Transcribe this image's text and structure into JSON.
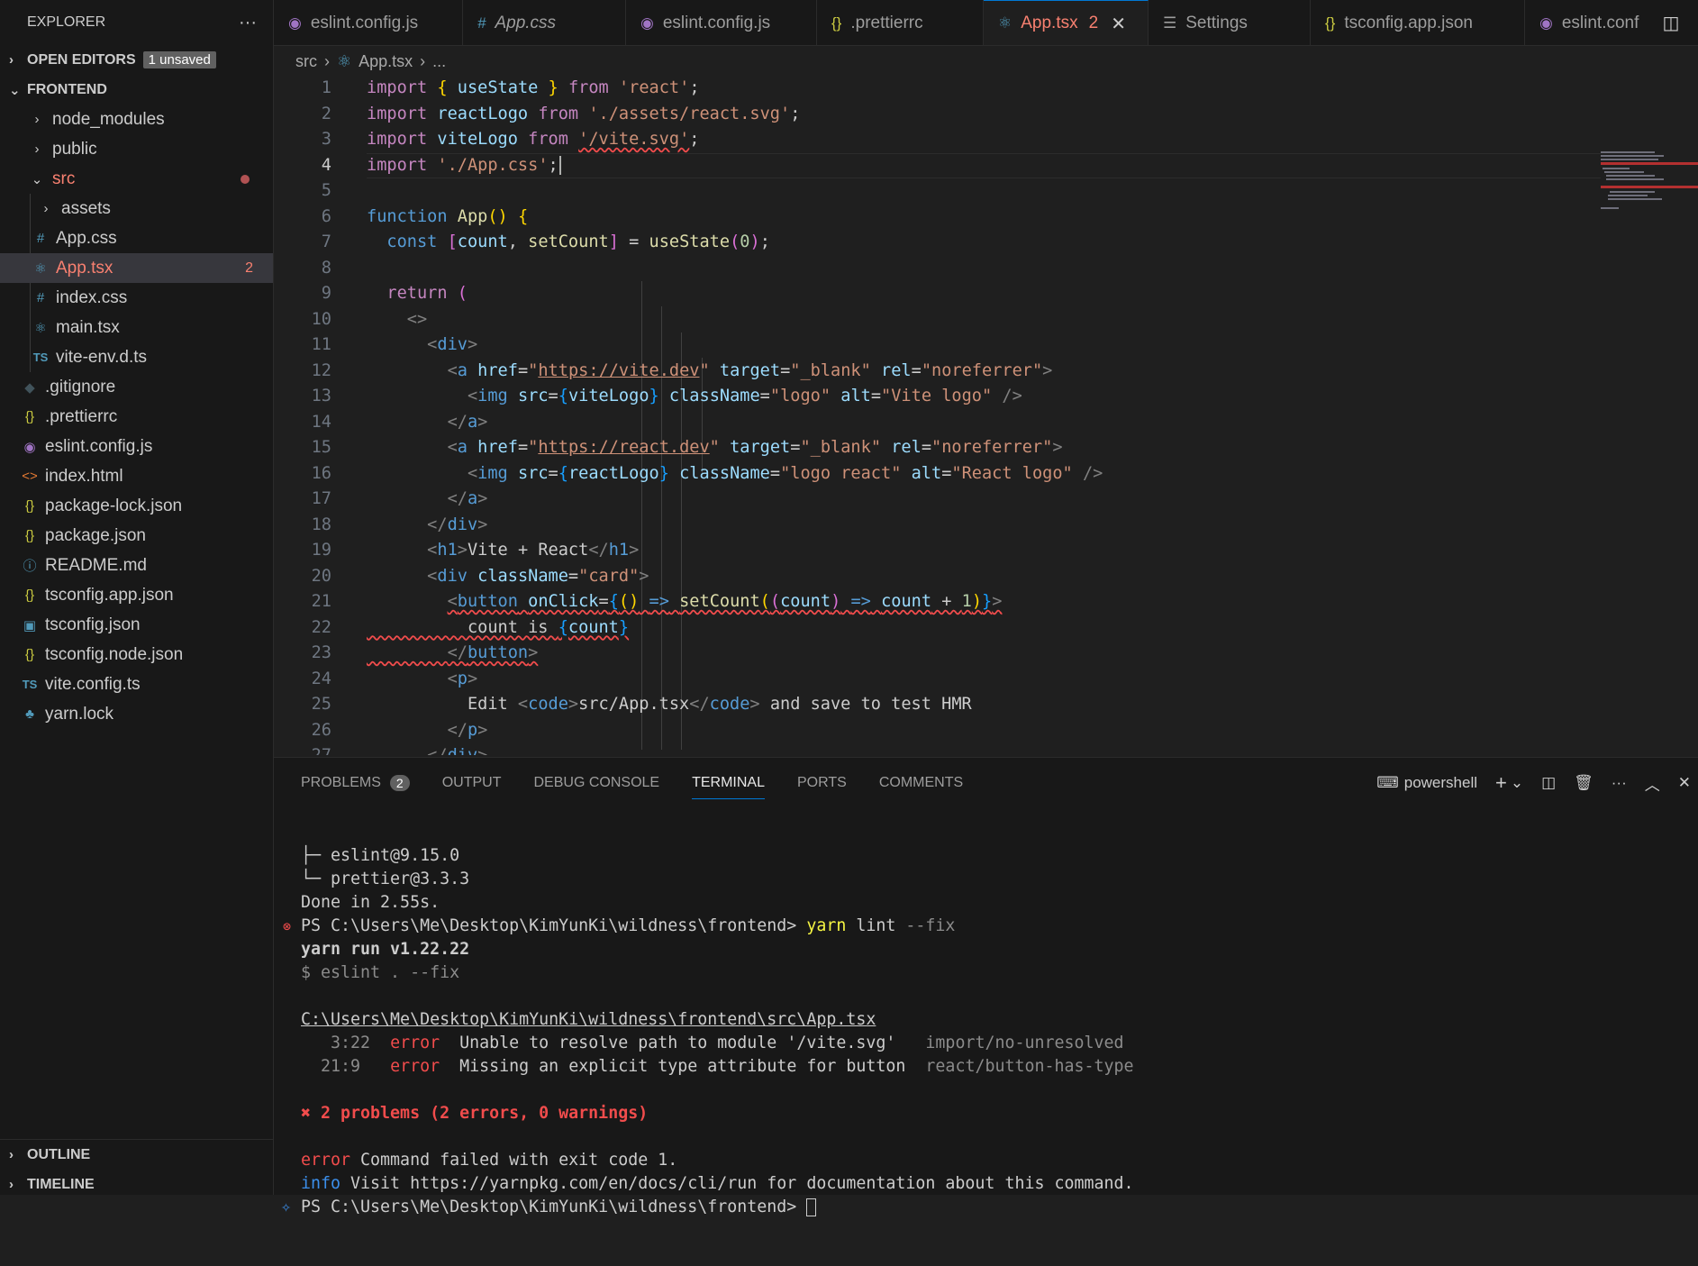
{
  "sidebar": {
    "title": "EXPLORER",
    "more": "···",
    "open_editors": {
      "label": "OPEN EDITORS",
      "badge": "1 unsaved"
    },
    "project": "FRONTEND",
    "items": [
      {
        "label": "node_modules",
        "icon": "chevron-right"
      },
      {
        "label": "public",
        "icon": "chevron-right"
      },
      {
        "label": "src",
        "icon": "chevron-down"
      },
      {
        "label": "assets",
        "icon": "chevron-right"
      },
      {
        "label": "App.css",
        "icon": "#"
      },
      {
        "label": "App.tsx",
        "icon": "react",
        "count": "2"
      },
      {
        "label": "index.css",
        "icon": "#"
      },
      {
        "label": "main.tsx",
        "icon": "react"
      },
      {
        "label": "vite-env.d.ts",
        "icon": "TS"
      },
      {
        "label": ".gitignore",
        "icon": "git"
      },
      {
        "label": ".prettierrc",
        "icon": "{}"
      },
      {
        "label": "eslint.config.js",
        "icon": "eslint"
      },
      {
        "label": "index.html",
        "icon": "<>"
      },
      {
        "label": "package-lock.json",
        "icon": "{}"
      },
      {
        "label": "package.json",
        "icon": "{}"
      },
      {
        "label": "README.md",
        "icon": "info"
      },
      {
        "label": "tsconfig.app.json",
        "icon": "{}"
      },
      {
        "label": "tsconfig.json",
        "icon": "TS"
      },
      {
        "label": "tsconfig.node.json",
        "icon": "{}"
      },
      {
        "label": "vite.config.ts",
        "icon": "TS"
      },
      {
        "label": "yarn.lock",
        "icon": "yarn"
      }
    ],
    "outline": "OUTLINE",
    "timeline": "TIMELINE"
  },
  "tabs": [
    {
      "label": "eslint.config.js",
      "icon": "eslint"
    },
    {
      "label": "App.css",
      "icon": "#"
    },
    {
      "label": "eslint.config.js",
      "icon": "eslint"
    },
    {
      "label": ".prettierrc",
      "icon": "{}"
    },
    {
      "label": "App.tsx",
      "icon": "react",
      "count": "2",
      "close": "✕"
    },
    {
      "label": "Settings",
      "icon": "settings"
    },
    {
      "label": "tsconfig.app.json",
      "icon": "{}"
    },
    {
      "label": "eslint.conf",
      "icon": "eslint"
    }
  ],
  "breadcrumb": {
    "folder": "src",
    "file": "App.tsx",
    "rest": "..."
  },
  "editor": {
    "line_numbers": [
      "1",
      "2",
      "3",
      "4",
      "5",
      "6",
      "7",
      "8",
      "9",
      "10",
      "11",
      "12",
      "13",
      "14",
      "15",
      "16",
      "17",
      "18",
      "19",
      "20",
      "21",
      "22",
      "23",
      "24",
      "25",
      "26",
      "27"
    ],
    "current_line": "4"
  },
  "panel": {
    "tabs": {
      "problems": "PROBLEMS",
      "problems_count": "2",
      "output": "OUTPUT",
      "debug": "DEBUG CONSOLE",
      "terminal": "TERMINAL",
      "ports": "PORTS",
      "comments": "COMMENTS"
    },
    "shell": "powershell",
    "terminal": {
      "l1": "├─ eslint@9.15.0",
      "l2": "└─ prettier@3.3.3",
      "l3": "Done in 2.55s.",
      "prompt": "PS C:\\Users\\Me\\Desktop\\KimYunKi\\wildness\\frontend> ",
      "cmd": "yarn",
      "cmd_args": " lint",
      "cmd_flag": " --fix",
      "l5": "yarn run v1.22.22",
      "l6": "$ eslint . --fix",
      "file": "C:\\Users\\Me\\Desktop\\KimYunKi\\wildness\\frontend\\src\\App.tsx",
      "e1_pos": "   3:22",
      "e1_sev": "error",
      "e1_msg": "Unable to resolve path to module '/vite.svg'",
      "e1_rule": "import/no-unresolved",
      "e2_pos": "  21:9",
      "e2_sev": "error",
      "e2_msg": "Missing an explicit type attribute for button",
      "e2_rule": "react/button-has-type",
      "summary": "✖ 2 problems (2 errors, 0 warnings)",
      "fail_tag": "error",
      "fail_msg": " Command failed with exit code 1.",
      "info_tag": "info",
      "info_msg": " Visit https://yarnpkg.com/en/docs/cli/run for documentation about this command.",
      "last_prompt": "PS C:\\Users\\Me\\Desktop\\KimYunKi\\wildness\\frontend> "
    }
  },
  "colors": {
    "accent": "#0078d4",
    "error": "#f14c4c",
    "modified": "#f88070"
  }
}
